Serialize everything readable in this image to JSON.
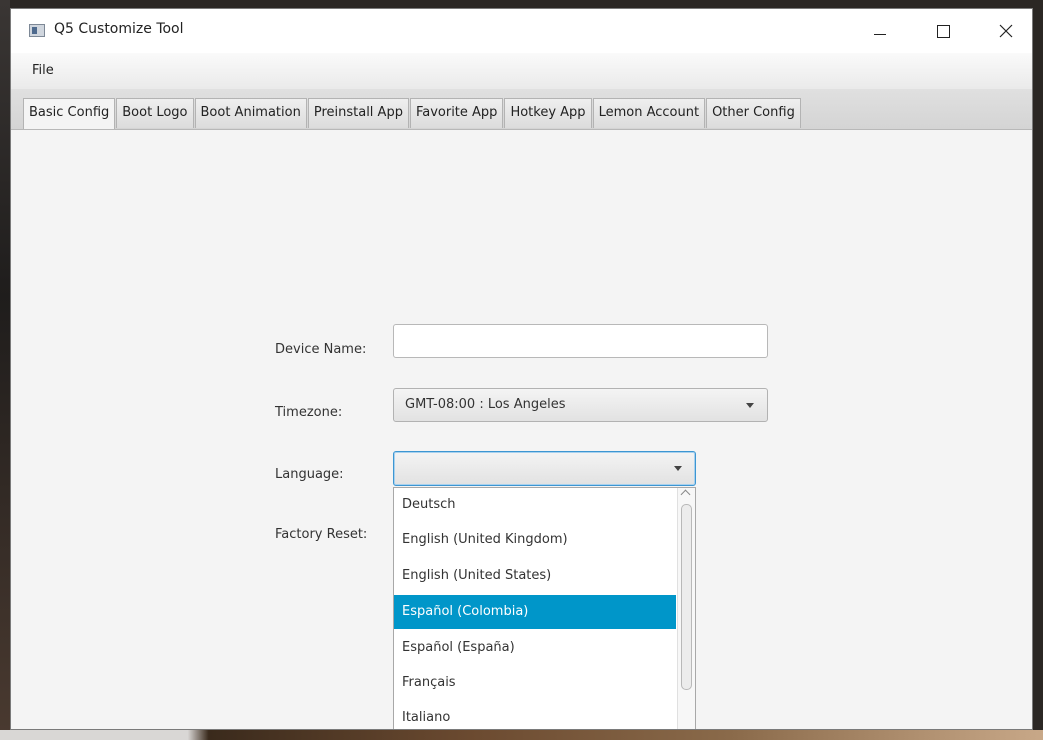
{
  "window": {
    "title": "Q5 Customize Tool"
  },
  "menu": {
    "file": "File"
  },
  "tabs": [
    {
      "label": "Basic Config"
    },
    {
      "label": "Boot Logo"
    },
    {
      "label": "Boot Animation"
    },
    {
      "label": "Preinstall App"
    },
    {
      "label": "Favorite App"
    },
    {
      "label": "Hotkey App"
    },
    {
      "label": "Lemon Account"
    },
    {
      "label": "Other Config"
    }
  ],
  "active_tab": "Basic Config",
  "form": {
    "device_name_label": "Device Name:",
    "device_name_value": "",
    "timezone_label": "Timezone:",
    "timezone_value": "GMT-08:00 : Los Angeles",
    "language_label": "Language:",
    "language_value": "",
    "factory_reset_label": "Factory Reset:"
  },
  "language_options": [
    "Deutsch",
    "English (United Kingdom)",
    "English (United States)",
    "Español (Colombia)",
    "Español (España)",
    "Français",
    "Italiano"
  ],
  "language_highlighted": "Español (Colombia)",
  "icons": {
    "app": "app-window-icon",
    "minimize": "minimize-icon",
    "maximize": "maximize-icon",
    "close": "close-icon",
    "dropdown": "chevron-down-icon",
    "scroll_up": "chevron-up-icon"
  },
  "colors": {
    "selection": "#0096c9",
    "focus_border": "#3d96d2"
  }
}
